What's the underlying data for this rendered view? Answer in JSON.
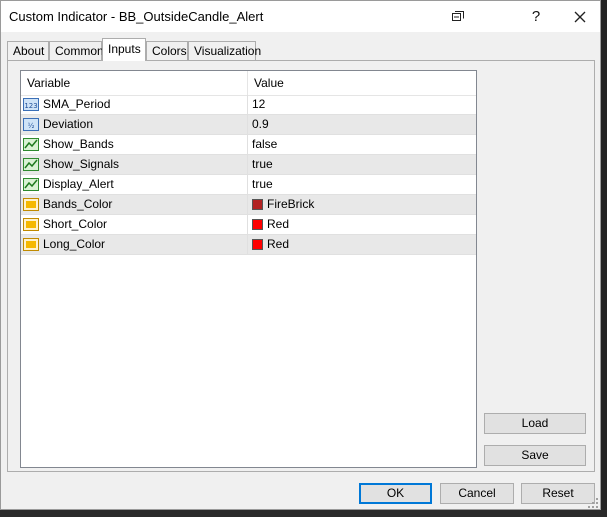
{
  "window": {
    "title": "Custom Indicator - BB_OutsideCandle_Alert",
    "help_glyph": "?",
    "icons": [
      "restore-icon",
      "help-icon",
      "close-icon"
    ]
  },
  "tabs": [
    {
      "label": "About",
      "active": false
    },
    {
      "label": "Common",
      "active": false
    },
    {
      "label": "Inputs",
      "active": true
    },
    {
      "label": "Colors",
      "active": false
    },
    {
      "label": "Visualization",
      "active": false
    }
  ],
  "inputs_table": {
    "headers": {
      "variable": "Variable",
      "value": "Value"
    },
    "rows": [
      {
        "icon": "integer-icon",
        "name": "SMA_Period",
        "value": "12"
      },
      {
        "icon": "double-icon",
        "name": "Deviation",
        "value": "0.9"
      },
      {
        "icon": "boolean-icon",
        "name": "Show_Bands",
        "value": "false"
      },
      {
        "icon": "boolean-icon",
        "name": "Show_Signals",
        "value": "true"
      },
      {
        "icon": "boolean-icon",
        "name": "Display_Alert",
        "value": "true"
      },
      {
        "icon": "color-icon",
        "name": "Bands_Color",
        "value": "FireBrick",
        "swatch": "#b22222"
      },
      {
        "icon": "color-icon",
        "name": "Short_Color",
        "value": "Red",
        "swatch": "#ff0000"
      },
      {
        "icon": "color-icon",
        "name": "Long_Color",
        "value": "Red",
        "swatch": "#ff0000"
      }
    ]
  },
  "side_buttons": {
    "load": "Load",
    "save": "Save"
  },
  "footer_buttons": {
    "ok": "OK",
    "cancel": "Cancel",
    "reset": "Reset"
  },
  "colors": {
    "accent": "#0078d7",
    "alt_row": "#e8e8e8"
  }
}
